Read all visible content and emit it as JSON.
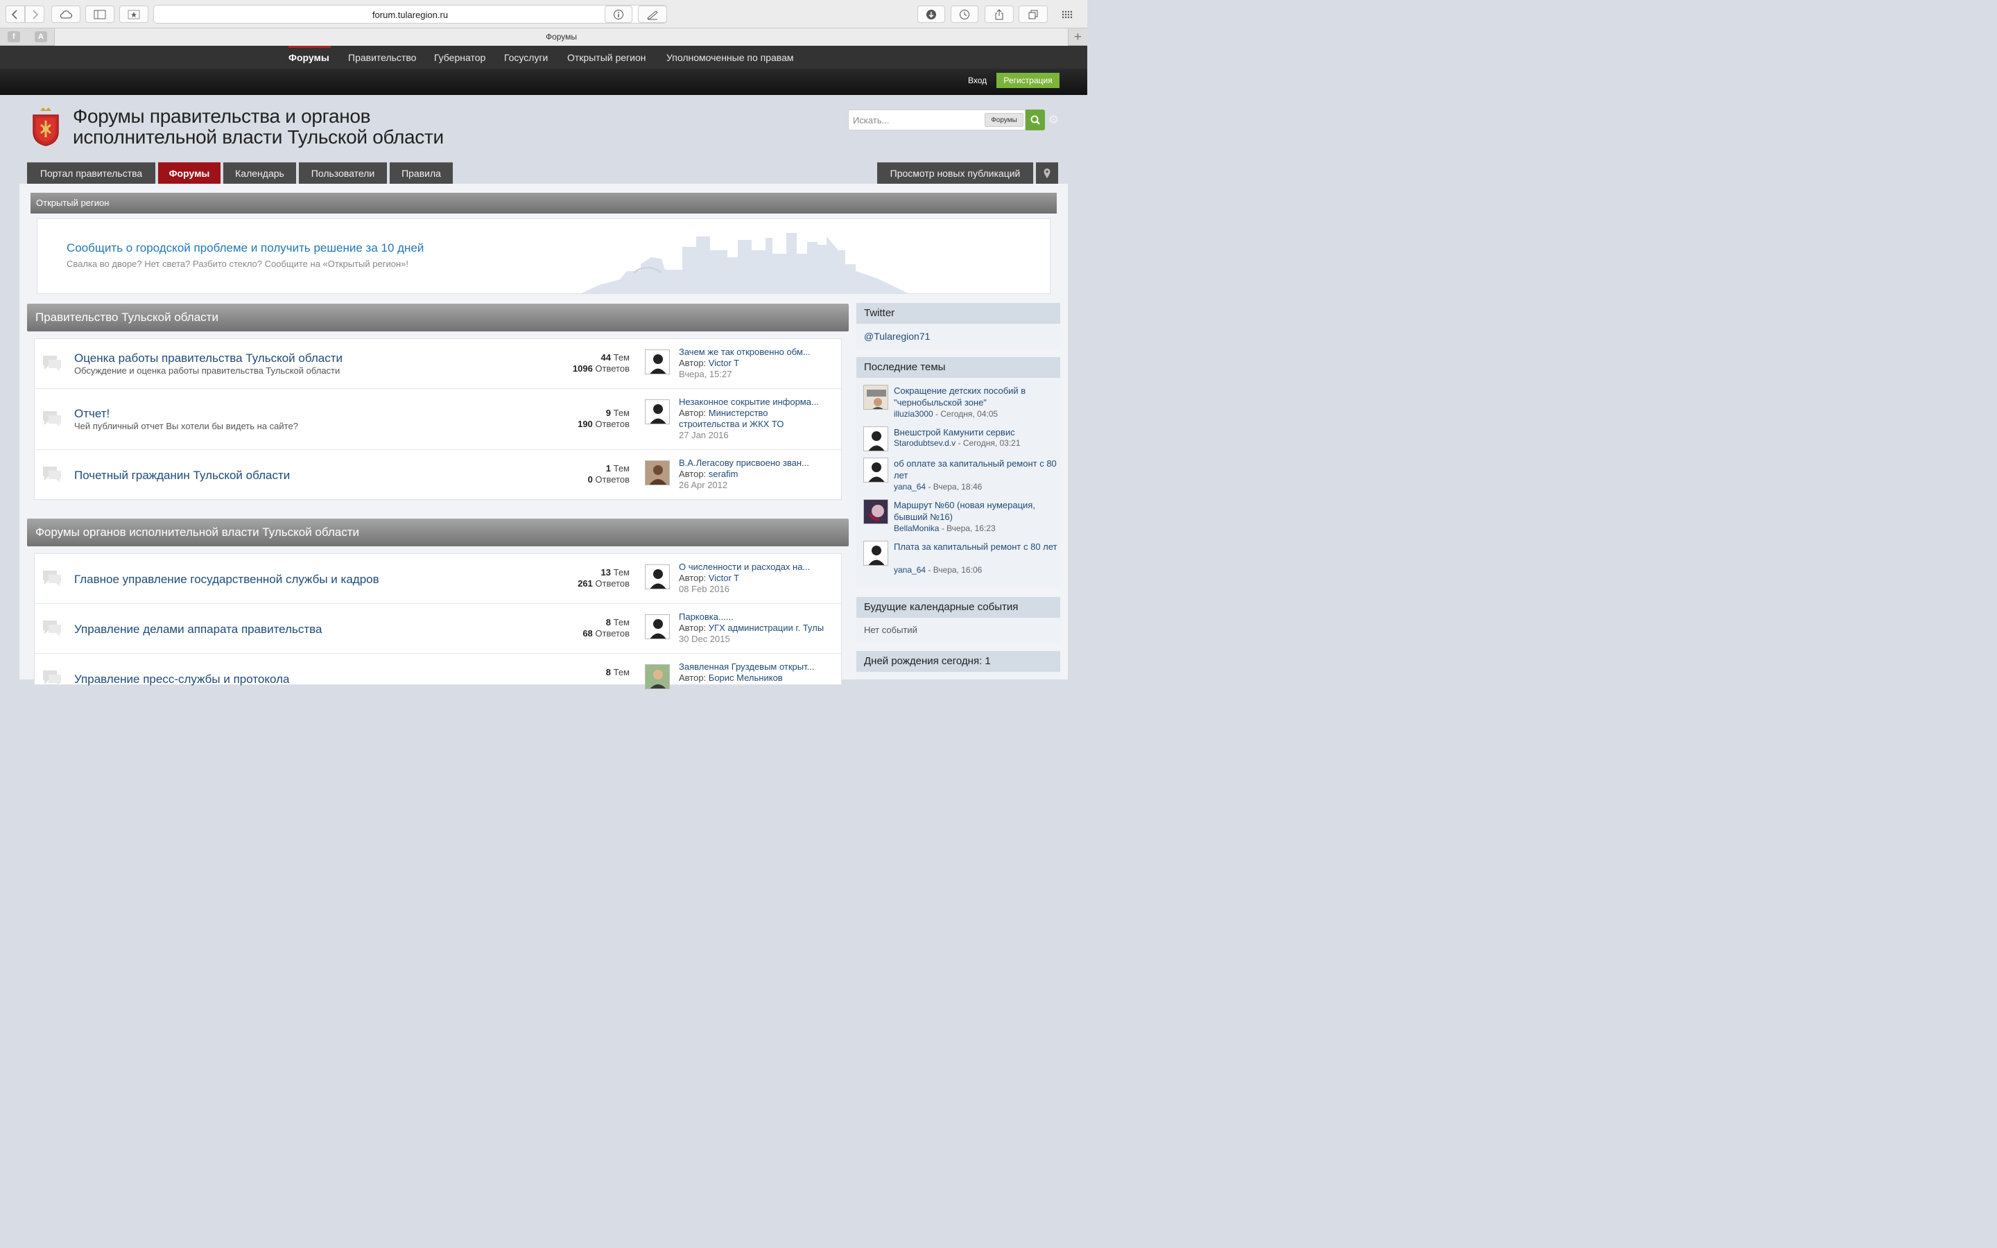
{
  "browser": {
    "url": "forum.tularegion.ru",
    "tab_title": "Форумы",
    "tab_plus": "+"
  },
  "topnav": [
    "Форумы",
    "Правительство",
    "Губернатор",
    "Госуслуги",
    "Открытый регион",
    "Уполномоченные по правам"
  ],
  "userbar": {
    "login": "Вход",
    "register": "Регистрация"
  },
  "header": {
    "title_line1": "Форумы правительства и органов",
    "title_line2": "исполнительной власти Тульской области",
    "search_placeholder": "Искать...",
    "search_scope": "Форумы"
  },
  "main_tabs": [
    "Портал правительства",
    "Форумы",
    "Календарь",
    "Пользователи",
    "Правила"
  ],
  "new_posts": "Просмотр новых публикаций",
  "open_region": {
    "header": "Открытый регион",
    "title": "Сообщить о городской проблеме и получить решение за 10 дней",
    "subtitle": "Свалка во дворе? Нет света? Разбито стекло? Сообщите на «Открытый регион»!"
  },
  "categories": [
    {
      "title": "Правительство Тульской области",
      "forums": [
        {
          "name": "Оценка работы правительства Тульской области",
          "desc": "Обсуждение и оценка работы правительства Тульской области",
          "topics": "44",
          "topics_label": "Тем",
          "replies": "1096",
          "replies_label": "Ответов",
          "last_title": "Зачем же так откровенно обм...",
          "last_author_prefix": "Автор:",
          "last_author": "Victor T",
          "last_author2": "",
          "last_date": "Вчера, 15:27"
        },
        {
          "name": "Отчет!",
          "desc": "Чей публичный отчет Вы хотели бы видеть на сайте?",
          "topics": "9",
          "topics_label": "Тем",
          "replies": "190",
          "replies_label": "Ответов",
          "last_title": "Незаконное сокрытие информа...",
          "last_author_prefix": "Автор:",
          "last_author": "Министерство",
          "last_author2": "строительства и ЖКХ ТО",
          "last_date": "27 Jan 2016"
        },
        {
          "name": "Почетный гражданин Тульской области",
          "desc": "",
          "topics": "1",
          "topics_label": "Тем",
          "replies": "0",
          "replies_label": "Ответов",
          "last_title": "В.А.Легасову присвоено зван...",
          "last_author_prefix": "Автор:",
          "last_author": "serafim",
          "last_author2": "",
          "last_date": "26 Apr 2012"
        }
      ]
    },
    {
      "title": "Форумы органов исполнительной власти Тульской области",
      "forums": [
        {
          "name": "Главное управление государственной службы и кадров",
          "desc": "",
          "topics": "13",
          "topics_label": "Тем",
          "replies": "261",
          "replies_label": "Ответов",
          "last_title": "О численности и расходах на...",
          "last_author_prefix": "Автор:",
          "last_author": "Victor T",
          "last_author2": "",
          "last_date": "08 Feb 2016"
        },
        {
          "name": "Управление делами аппарата правительства",
          "desc": "",
          "topics": "8",
          "topics_label": "Тем",
          "replies": "68",
          "replies_label": "Ответов",
          "last_title": "Парковка......",
          "last_author_prefix": "Автор:",
          "last_author": "УГХ администрации г. Тулы",
          "last_author2": "",
          "last_date": "30 Dec 2015"
        },
        {
          "name": "Управление пресс-службы и протокола",
          "desc": "",
          "topics": "8",
          "topics_label": "Тем",
          "replies": "",
          "replies_label": "",
          "last_title": "Заявленная Груздевым открыт...",
          "last_author_prefix": "Автор:",
          "last_author": "Борис Мельников",
          "last_author2": "",
          "last_date": ""
        }
      ]
    }
  ],
  "sidebar": {
    "twitter_title": "Twitter",
    "twitter_handle": "@Tularegion71",
    "recent_title": "Последние темы",
    "recent": [
      {
        "title": "Сокращение детских пособий в \"чернобыльской зоне\"",
        "user": "illuzia3000",
        "time": " - Сегодня, 04:05"
      },
      {
        "title": "Внешстрой Камунити сервис",
        "user": "Starodubtsev.d.v",
        "time": " - Сегодня, 03:21"
      },
      {
        "title": "об оплате за капитальный ремонт с 80 лет",
        "user": "yana_64",
        "time": " - Вчера, 18:46"
      },
      {
        "title": "Маршрут №60 (новая нумерация, бывший №16)",
        "user": "BellaMonika",
        "time": " - Вчера, 16:23"
      },
      {
        "title": "Плата за капитальный ремонт с 80 лет",
        "user": "yana_64",
        "time": " - Вчера, 16:06"
      }
    ],
    "events_title": "Будущие календарные события",
    "events_empty": "Нет событий",
    "birthdays_title": "Дней рождения сегодня: 1"
  }
}
